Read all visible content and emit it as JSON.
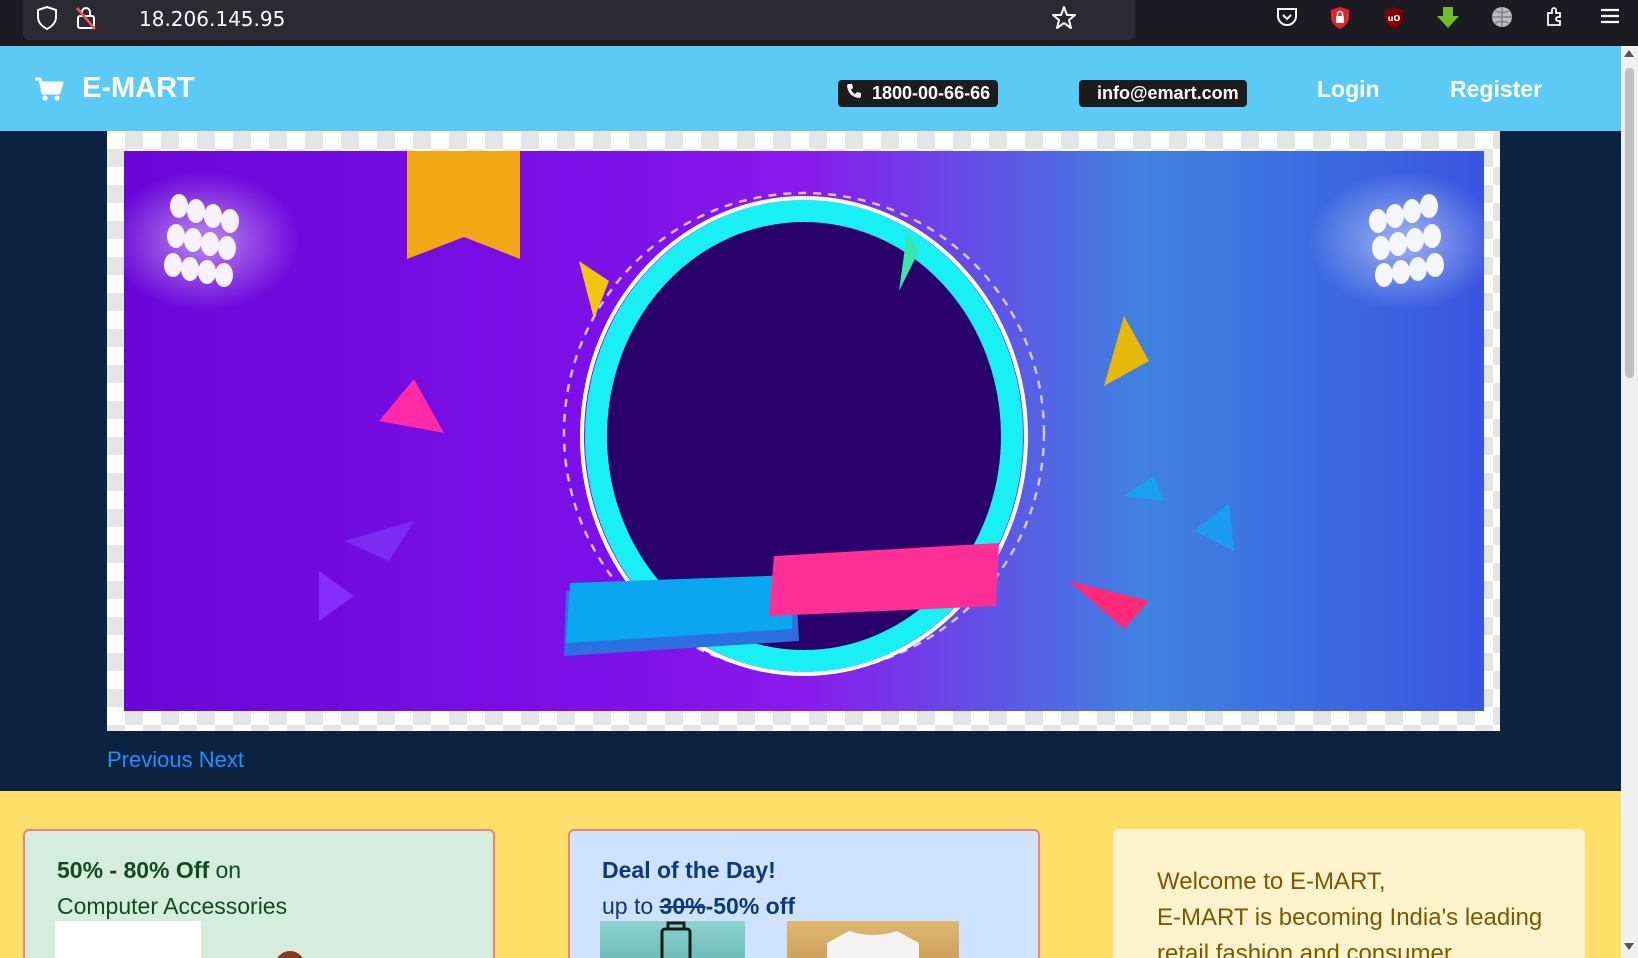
{
  "browser": {
    "url": "18.206.145.95",
    "icons": [
      "shield-icon",
      "insecure-lock-icon",
      "star-icon",
      "pocket-icon",
      "extension-red-shield-icon",
      "ublock-icon",
      "download-arrow-icon",
      "globe-icon",
      "extensions-puzzle-icon",
      "menu-icon"
    ]
  },
  "nav": {
    "brand": "E-MART",
    "phone": "1800-00-66-66",
    "email": "info@emart.com",
    "login": "Login",
    "register": "Register"
  },
  "carousel": {
    "previous": "Previous",
    "next": "Next"
  },
  "promos": {
    "card1": {
      "title_bold": "50% - 80% Off",
      "title_rest": " on",
      "subtitle": "Computer Accessories"
    },
    "card2": {
      "title": "Deal of the Day!",
      "sub_prefix": "up to ",
      "sub_strike": "30%",
      "sub_rest": "-50% off"
    },
    "card3": {
      "line1": "Welcome to E-MART,",
      "line2": "E-MART is becoming India's leading",
      "line3": "retail fashion and consumer"
    }
  },
  "colors": {
    "navbar": "#5bcbf5",
    "hero_bg": "#0b2340",
    "promo_bg": "#fde06a",
    "link": "#1e90ff"
  }
}
